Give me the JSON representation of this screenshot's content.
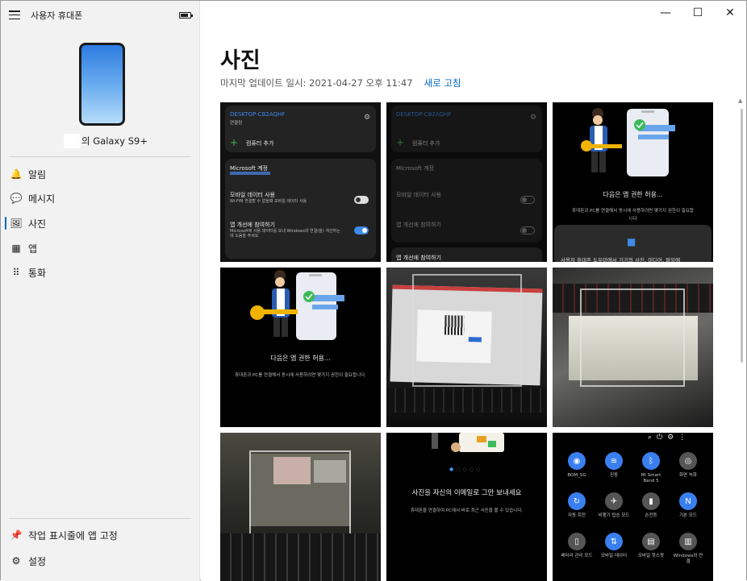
{
  "window": {
    "app_title": "사용자 휴대폰",
    "device_name": "의 Galaxy S9+",
    "battery_level": 0.8,
    "controls": [
      "—",
      "☐",
      "✕"
    ]
  },
  "sidebar": {
    "items": [
      {
        "label": "알림",
        "icon": "bell-icon",
        "glyph": "🔔"
      },
      {
        "label": "메시지",
        "icon": "message-icon",
        "glyph": "💬"
      },
      {
        "label": "사진",
        "icon": "photos-icon",
        "glyph": "🖼"
      },
      {
        "label": "앱",
        "icon": "apps-icon",
        "glyph": "▦"
      },
      {
        "label": "통화",
        "icon": "dialpad-icon",
        "glyph": "⠿"
      }
    ],
    "footer": [
      {
        "label": "작업 표시줄에 앱 고정",
        "icon": "pin-icon",
        "glyph": "📌"
      },
      {
        "label": "설정",
        "icon": "gear-icon",
        "glyph": "⚙"
      }
    ]
  },
  "main": {
    "title": "사진",
    "last_update": "마지막 업데이트 일시: 2021-04-27 오후 11:47",
    "refresh": "새로 고침"
  },
  "photos": {
    "t1": {
      "pc_name": "DESKTOP-CB2AQHF",
      "pc_status": "연결됨",
      "add_pc": "컴퓨터 추가",
      "account_title": "Microsoft 계정",
      "mobile_data_title": "모바일 데이터 사용",
      "mobile_data_desc": "Wi-Fi에 연결할 수 없을때 모바일 데이터 사용",
      "improve_title": "앱 개선에 참여하기",
      "improve_desc": "Microsoft에 사용 데이터를 보내 Windows와 연결(을) 개선하는 데 도움을 주세요"
    },
    "t2": {
      "pc_name": "DESKTOP-CB2AQHF",
      "add_pc": "컴퓨터 추가",
      "account_title": "Microsoft 계정",
      "mobile_data_title": "모바일 데이터 사용",
      "improve_title": "앱 개선에 참여하기",
      "bottom_title": "앱 개선에 참여하기"
    },
    "t3": {
      "title": "다음은 앱 권한 허용...",
      "desc": "휴대폰과 PC를 연결해서 동시에 사용하려면 몇가지 권한이 필요합니다",
      "banner": "사용자 휴대폰 도우미에서 기기의 사진, 미디어, 파일에"
    },
    "t4": {
      "title": "다음은 앱 권한 허용...",
      "desc": "휴대폰과 PC를 연결해서 동시에 사용하려면 몇가지 권한이 필요합니다."
    },
    "t8": {
      "title": "사진을 자신의 이메일로 그만 보내세요",
      "desc": "휴대폰을 연결하여 PC에서 바로 최근 사진을 볼 수 있습니다."
    },
    "t9": {
      "tiles": [
        {
          "label": "BOM_5G",
          "icon": "wifi-icon",
          "glyph": "◉",
          "color": "#3a7ff0"
        },
        {
          "label": "진동",
          "icon": "vibrate-icon",
          "glyph": "≋",
          "color": "#3a7ff0"
        },
        {
          "label": "Mi Smart Band 5",
          "icon": "bluetooth-icon",
          "glyph": "ᛒ",
          "color": "#3a7ff0"
        },
        {
          "label": "화면 녹화",
          "icon": "screen-record-icon",
          "glyph": "◎",
          "color": "#555555"
        },
        {
          "label": "자동 회전",
          "icon": "rotate-icon",
          "glyph": "↻",
          "color": "#3a7ff0"
        },
        {
          "label": "비행기 탑승 모드",
          "icon": "airplane-icon",
          "glyph": "✈",
          "color": "#555555"
        },
        {
          "label": "손전등",
          "icon": "flashlight-icon",
          "glyph": "▮",
          "color": "#555555"
        },
        {
          "label": "기본 모드",
          "icon": "nfc-icon",
          "glyph": "N",
          "color": "#3a7ff0"
        },
        {
          "label": "배터리 관리 모드",
          "icon": "battery-icon",
          "glyph": "▯",
          "color": "#555555"
        },
        {
          "label": "모바일 데이터",
          "icon": "data-icon",
          "glyph": "⇅",
          "color": "#3a7ff0"
        },
        {
          "label": "모바일 핫스팟",
          "icon": "hotspot-icon",
          "glyph": "▤",
          "color": "#555555"
        },
        {
          "label": "Windows와 연결",
          "icon": "link-windows-icon",
          "glyph": "▥",
          "color": "#555555"
        }
      ]
    }
  }
}
